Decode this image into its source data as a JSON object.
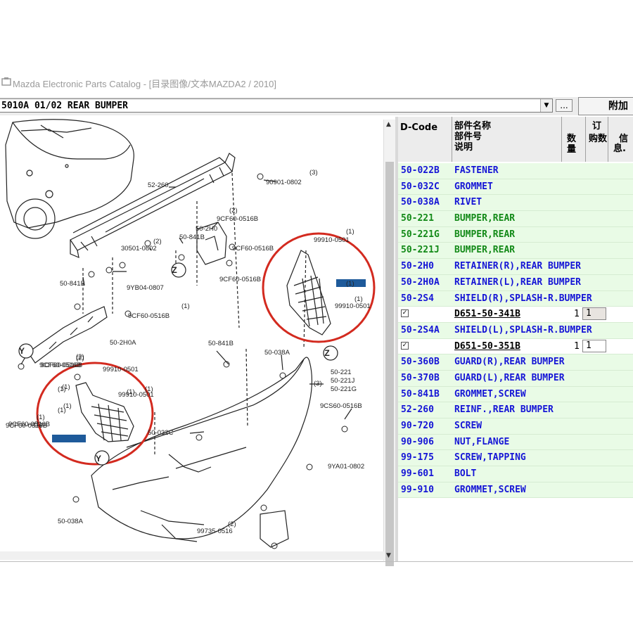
{
  "window": {
    "title": "Mazda Electronic Parts Catalog - [目录图像/文本MAZDA2 / 2010]"
  },
  "toolbar": {
    "section_value": "5010A 01/02 REAR BUMPER",
    "browse_label": "...",
    "attach_label": "附加"
  },
  "diagram": {
    "body_labels": [
      "52-260",
      "90901-0802",
      "(3)",
      "50-2H0",
      "9CF60-0516B",
      "(2)",
      "30501-0802",
      "(2)",
      "50-841B",
      "9CF60-0516B",
      "Z",
      "9YB04-0807",
      "50-841B",
      "9CF60-0516B",
      "(1)",
      "50-2H0A",
      "Y",
      "9CF60-0516B",
      "(2)",
      "(1)",
      "50-841B",
      "50-038A",
      "Z",
      "50-221",
      "50-221J",
      "50-221G",
      "9CS60-0516B",
      "50-032C",
      "9YA01-0802",
      "50-038A",
      "99735-0516",
      "(2)",
      "(3)",
      "(1)",
      "9CF60-0516B",
      "(1)",
      "(1)",
      "(1)"
    ],
    "right_callout_labels": [
      "99910-0501",
      "(1)",
      "(1)",
      "9CF60-0516B",
      "99910-0501",
      "(1)"
    ],
    "left_callout_labels": [
      "99910-0501",
      "(2)",
      "9CF60-0516B",
      "(1)",
      "99910-0501",
      "(1)",
      "9CF60-0516B",
      "(1)",
      "Y"
    ],
    "callout_color": "#d32a1f"
  },
  "parts_table": {
    "headers": {
      "dcode": "D-Code",
      "name_l1": "部件名称",
      "name_l2": "部件号",
      "name_l3": "说明",
      "qty": "数量",
      "ord_l1": "订",
      "ord_l2": "购数",
      "info_l1": "信",
      "info_l2": "息."
    },
    "rows": [
      {
        "code": "50-022B",
        "name": "FASTENER",
        "color": "#1515d6"
      },
      {
        "code": "50-032C",
        "name": "GROMMET",
        "color": "#1515d6"
      },
      {
        "code": "50-038A",
        "name": "RIVET",
        "color": "#1515d6"
      },
      {
        "code": "50-221",
        "name": "BUMPER,REAR",
        "color": "#138a18"
      },
      {
        "code": "50-221G",
        "name": "BUMPER,REAR",
        "color": "#138a18"
      },
      {
        "code": "50-221J",
        "name": "BUMPER,REAR",
        "color": "#138a18"
      },
      {
        "code": "50-2H0",
        "name": "RETAINER(R),REAR BUMPER",
        "color": "#1515d6"
      },
      {
        "code": "50-2H0A",
        "name": "RETAINER(L),REAR BUMPER",
        "color": "#1515d6"
      },
      {
        "code": "50-2S4",
        "name": "SHIELD(R),SPLASH-R.BUMPER",
        "color": "#1515d6"
      }
    ],
    "sub1": {
      "check": "✓",
      "part_no": "D651-50-341B",
      "qty": "1",
      "order": "1"
    },
    "row2S4A": {
      "code": "50-2S4A",
      "name": "SHIELD(L),SPLASH-R.BUMPER",
      "color": "#1515d6"
    },
    "sub2": {
      "check": "✓",
      "part_no": "D651-50-351B",
      "qty": "1",
      "order": "1"
    },
    "rows_after": [
      {
        "code": "50-360B",
        "name": "GUARD(R),REAR BUMPER",
        "color": "#1515d6"
      },
      {
        "code": "50-370B",
        "name": "GUARD(L),REAR BUMPER",
        "color": "#1515d6"
      },
      {
        "code": "50-841B",
        "name": "GROMMET,SCREW",
        "color": "#1515d6"
      },
      {
        "code": "52-260",
        "name": "REINF.,REAR BUMPER",
        "color": "#1515d6"
      },
      {
        "code": "90-720",
        "name": "SCREW",
        "color": "#1515d6"
      },
      {
        "code": "90-906",
        "name": "NUT,FLANGE",
        "color": "#1515d6"
      },
      {
        "code": "99-175",
        "name": "SCREW,TAPPING",
        "color": "#1515d6"
      },
      {
        "code": "99-601",
        "name": "BOLT",
        "color": "#1515d6"
      },
      {
        "code": "99-910",
        "name": "GROMMET,SCREW",
        "color": "#1515d6"
      }
    ]
  }
}
